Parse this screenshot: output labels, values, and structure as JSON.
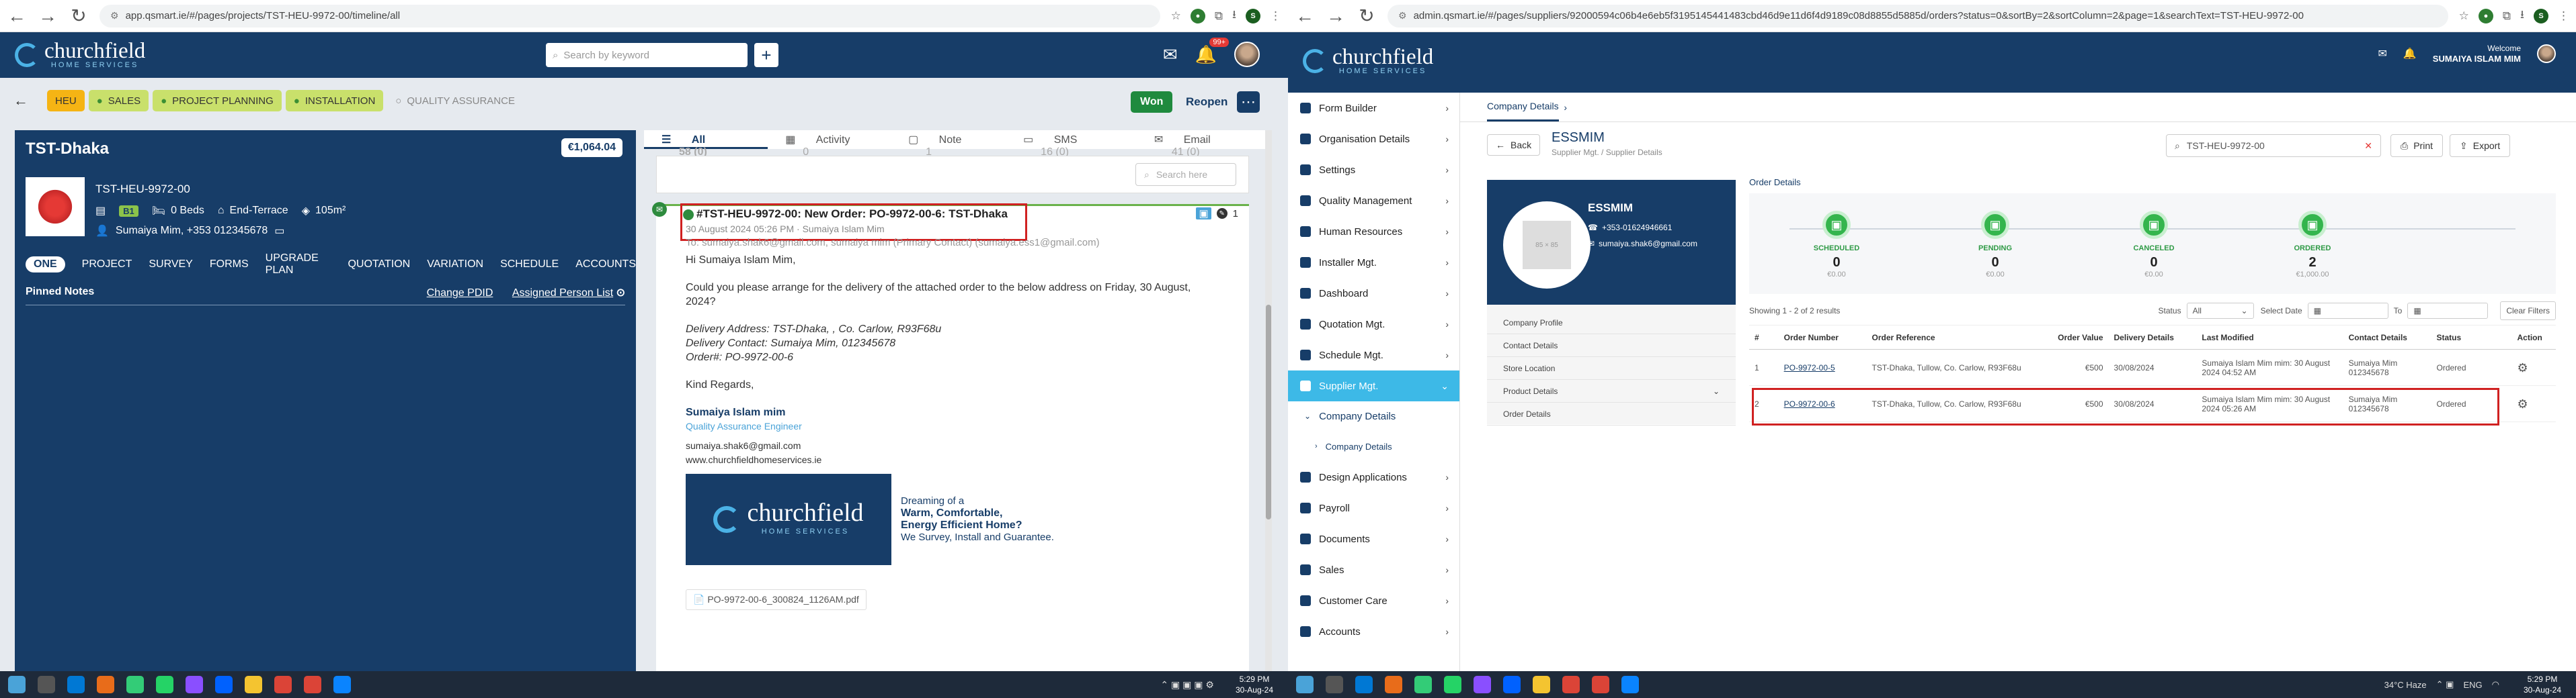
{
  "left": {
    "url": "app.qsmart.ie/#/pages/projects/TST-HEU-9972-00/timeline/all",
    "url_prefix": "app.qsmart.ie",
    "brand_name": "churchfield",
    "brand_sub": "HOME SERVICES",
    "search_placeholder": "Search by keyword",
    "notif_count": "99+",
    "stages": [
      "HEU",
      "SALES",
      "PROJECT PLANNING",
      "INSTALLATION",
      "QUALITY ASSURANCE"
    ],
    "won_label": "Won",
    "reopen_label": "Reopen",
    "project": {
      "title": "TST-Dhaka",
      "amount": "€1,064.04",
      "ref": "TST-HEU-9972-00",
      "ber": "B1",
      "beds": "0 Beds",
      "type": "End-Terrace",
      "area": "105m²",
      "contact": "Sumaiya Mim, +353 012345678"
    },
    "tabs": [
      "ONE",
      "PROJECT",
      "SURVEY",
      "FORMS",
      "UPGRADE PLAN",
      "QUOTATION",
      "VARIATION",
      "SCHEDULE",
      "ACCOUNTS"
    ],
    "pinned_label": "Pinned Notes",
    "change_pdid": "Change PDID",
    "assigned_list": "Assigned Person List",
    "filter_tabs": [
      {
        "label": "All",
        "count": "58 (0)"
      },
      {
        "label": "Activity",
        "count": "0"
      },
      {
        "label": "Note",
        "count": "1"
      },
      {
        "label": "SMS",
        "count": "16 (0)"
      },
      {
        "label": "Email",
        "count": "41 (0)"
      }
    ],
    "search_here": "Search here",
    "email": {
      "subject": "#TST-HEU-9972-00: New Order: PO-9972-00-6: TST-Dhaka",
      "date": "30 August 2024 05:26 PM · Sumaiya Islam Mim",
      "to": "To: sumaiya.shak6@gmail.com, sumaiya mim (Primary Contact) (sumaiya.ess1@gmail.com)",
      "count": "1",
      "greeting": "Hi Sumaiya Islam Mim,",
      "line1": "Could you please arrange for the delivery of the attached order to the below address on Friday, 30 August, 2024?",
      "delivery_address": "Delivery Address: TST-Dhaka, , Co. Carlow, R93F68u",
      "delivery_contact": "Delivery Contact: Sumaiya Mim, 012345678",
      "order_no": "Order#: PO-9972-00-6",
      "regards": "Kind Regards,",
      "sig_name": "Sumaiya Islam mim",
      "sig_role": "Quality Assurance Engineer",
      "sig_email": "sumaiya.shak6@gmail.com",
      "sig_web": "www.churchfieldhomeservices.ie",
      "banner_l1": "Dreaming of a",
      "banner_l2": "Warm, Comfortable,",
      "banner_l3": "Energy Efficient Home?",
      "banner_l4": "We Survey, Install and Guarantee.",
      "attachment": "PO-9972-00-6_300824_1126AM.pdf"
    }
  },
  "right": {
    "url": "admin.qsmart.ie/#/pages/suppliers/92000594c06b4e6eb5f3195145441483cbd46d9e11d6f4d9189c08d8855d5885d/orders?status=0&sortBy=2&sortColumn=2&page=1&searchText=TST-HEU-9972-00",
    "url_prefix": "admin.qsmart.ie",
    "welcome": "Welcome",
    "user": "SUMAIYA ISLAM MIM",
    "menu": [
      {
        "label": "Form Builder"
      },
      {
        "label": "Organisation Details"
      },
      {
        "label": "Settings"
      },
      {
        "label": "Quality Management"
      },
      {
        "label": "Human Resources"
      },
      {
        "label": "Installer Mgt."
      },
      {
        "label": "Dashboard"
      },
      {
        "label": "Quotation Mgt."
      },
      {
        "label": "Schedule Mgt."
      },
      {
        "label": "Supplier Mgt."
      },
      {
        "label": "Company Details"
      },
      {
        "label": "Company Details"
      },
      {
        "label": "Design Applications"
      },
      {
        "label": "Payroll"
      },
      {
        "label": "Documents"
      },
      {
        "label": "Sales"
      },
      {
        "label": "Customer Care"
      },
      {
        "label": "Accounts"
      }
    ],
    "crumb": "Company Details",
    "back_label": "Back",
    "company": "ESSMIM",
    "company_sub": "Supplier Mgt.  /  Supplier Details",
    "search_value": "TST-HEU-9972-00",
    "print_label": "Print",
    "export_label": "Export",
    "phone": "+353-01624946661",
    "email": "sumaiya.shak6@gmail.com",
    "photo_text": "85 × 85",
    "side_list": [
      "Company Profile",
      "Contact Details",
      "Store Location",
      "Product Details",
      "Order Details"
    ],
    "order_details_label": "Order Details",
    "steps": [
      {
        "label": "SCHEDULED",
        "count": "0",
        "amount": "€0.00"
      },
      {
        "label": "PENDING",
        "count": "0",
        "amount": "€0.00"
      },
      {
        "label": "CANCELED",
        "count": "0",
        "amount": "€0.00"
      },
      {
        "label": "ORDERED",
        "count": "2",
        "amount": "€1,000.00"
      }
    ],
    "showing": "Showing 1 - 2 of 2 results",
    "status_label": "Status",
    "status_value": "All",
    "select_date": "Select Date",
    "to_label": "To",
    "clear_filters": "Clear Filters",
    "columns": [
      "#",
      "Order Number",
      "Order Reference",
      "Order Value",
      "Delivery Details",
      "Last Modified",
      "Contact Details",
      "Status",
      "Action"
    ],
    "rows": [
      {
        "n": "1",
        "order": "PO-9972-00-5",
        "ref": "TST-Dhaka, Tullow, Co. Carlow, R93F68u",
        "value": "€500",
        "delivery": "30/08/2024",
        "modified": "Sumaiya Islam Mim mim: 30 August 2024 04:52 AM",
        "contact": "Sumaiya Mim 012345678",
        "status": "Ordered"
      },
      {
        "n": "2",
        "order": "PO-9972-00-6",
        "ref": "TST-Dhaka, Tullow, Co. Carlow, R93F68u",
        "value": "€500",
        "delivery": "30/08/2024",
        "modified": "Sumaiya Islam Mim mim: 30 August 2024 05:26 AM",
        "contact": "Sumaiya Mim 012345678",
        "status": "Ordered"
      }
    ]
  },
  "taskbar": {
    "time": "5:29 PM",
    "date": "30-Aug-24",
    "weather": "34°C  Haze",
    "lang": "ENG"
  }
}
